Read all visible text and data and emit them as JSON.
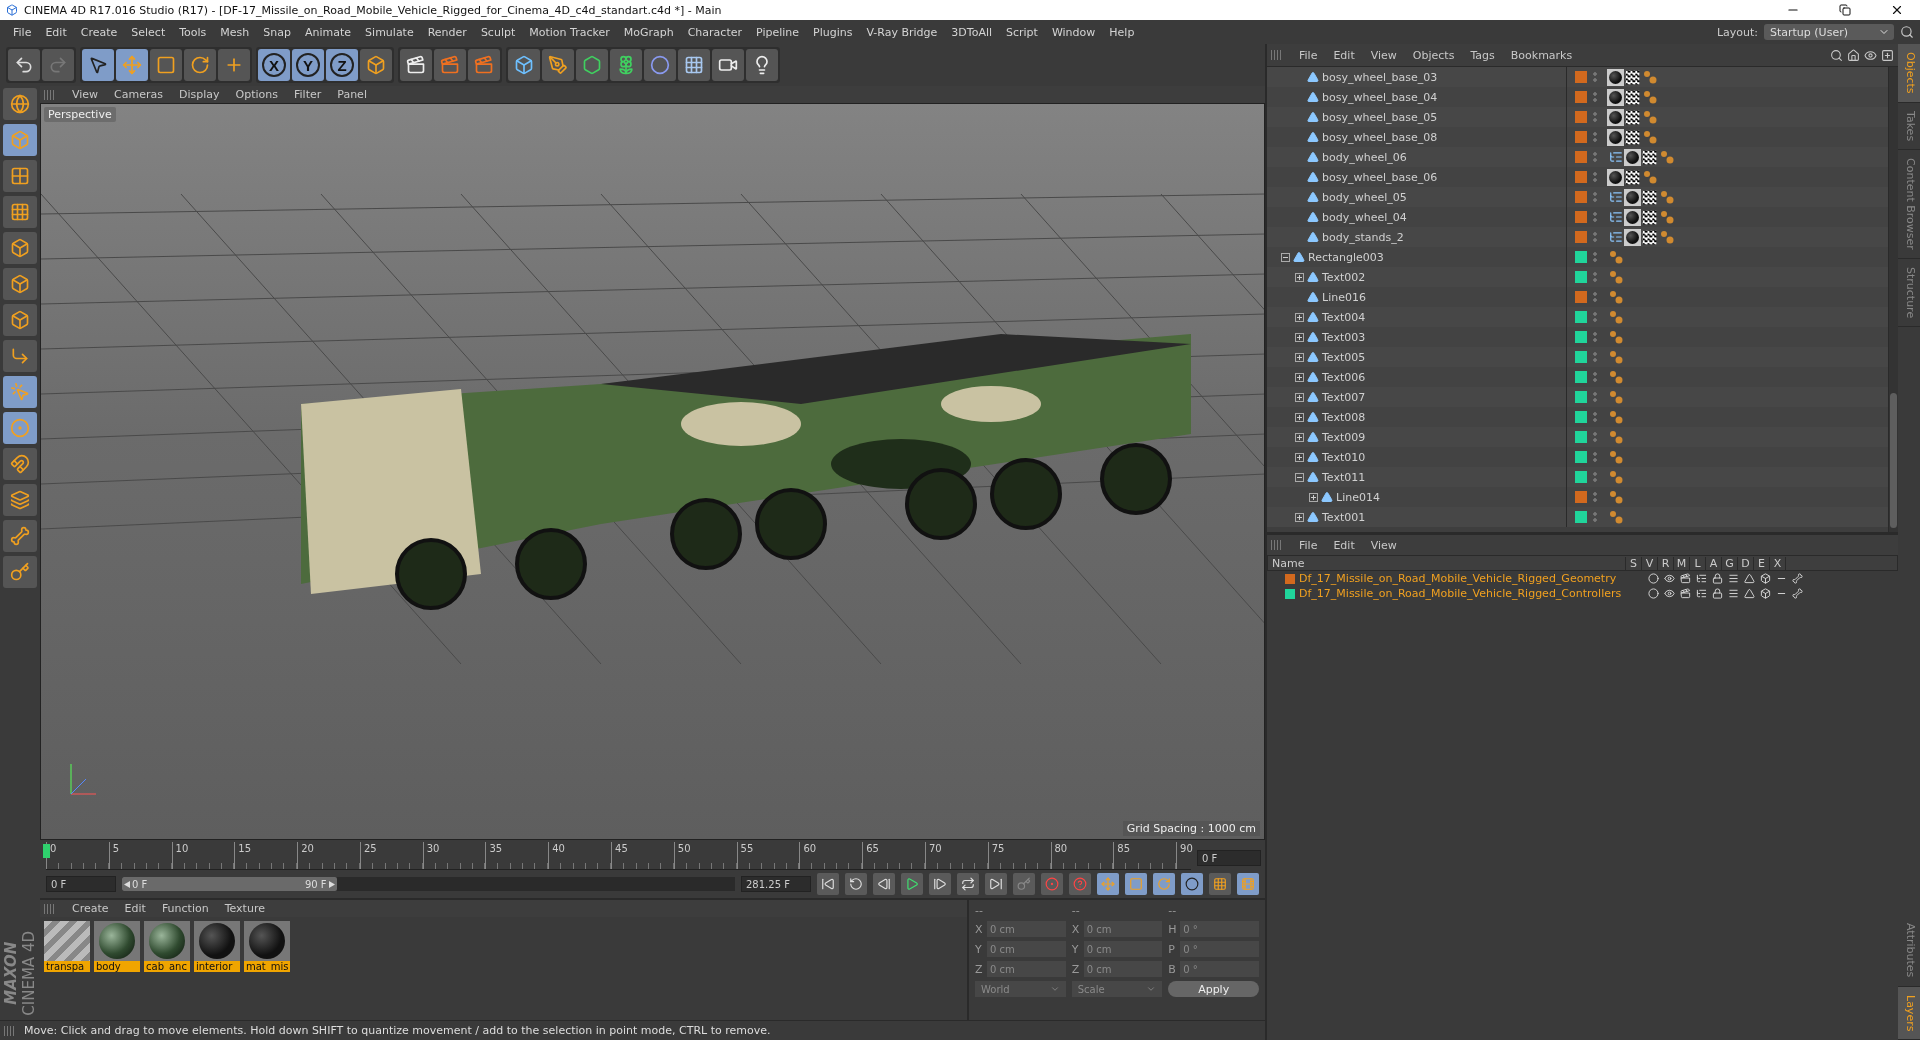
{
  "window": {
    "title": "CINEMA 4D R17.016 Studio (R17) - [DF-17_Missile_on_Road_Mobile_Vehicle_Rigged_for_Cinema_4D_c4d_standart.c4d *] - Main"
  },
  "menu": [
    "File",
    "Edit",
    "Create",
    "Select",
    "Tools",
    "Mesh",
    "Snap",
    "Animate",
    "Simulate",
    "Render",
    "Sculpt",
    "Motion Tracker",
    "MoGraph",
    "Character",
    "Pipeline",
    "Plugins",
    "V-Ray Bridge",
    "3DToAll",
    "Script",
    "Window",
    "Help"
  ],
  "layout": {
    "label": "Layout:",
    "value": "Startup (User)"
  },
  "axis_buttons": [
    "X",
    "Y",
    "Z"
  ],
  "viewport": {
    "menu": [
      "View",
      "Cameras",
      "Display",
      "Options",
      "Filter",
      "Panel"
    ],
    "camera": "Perspective",
    "grid_spacing": "Grid Spacing : 1000 cm"
  },
  "object_manager": {
    "menu": [
      "File",
      "Edit",
      "View",
      "Objects",
      "Tags",
      "Bookmarks"
    ],
    "partial_children": [
      {
        "name": "bosy_wheel_base_03",
        "color": "#d2691e",
        "skinned": false,
        "textured": true
      },
      {
        "name": "bosy_wheel_base_04",
        "color": "#d2691e",
        "skinned": false,
        "textured": true
      },
      {
        "name": "bosy_wheel_base_05",
        "color": "#d2691e",
        "skinned": false,
        "textured": true
      },
      {
        "name": "bosy_wheel_base_08",
        "color": "#d2691e",
        "skinned": false,
        "textured": true
      },
      {
        "name": "body_wheel_06",
        "color": "#d2691e",
        "skinned": true,
        "textured": true
      },
      {
        "name": "bosy_wheel_base_06",
        "color": "#d2691e",
        "skinned": false,
        "textured": true
      },
      {
        "name": "body_wheel_05",
        "color": "#d2691e",
        "skinned": true,
        "textured": true
      },
      {
        "name": "body_wheel_04",
        "color": "#d2691e",
        "skinned": true,
        "textured": true
      },
      {
        "name": "body_stands_2",
        "color": "#d2691e",
        "skinned": true,
        "textured": true
      }
    ],
    "items": [
      {
        "name": "Rectangle003",
        "color": "#20d59b",
        "skinned": false,
        "textured": false,
        "expanded": true,
        "children": [
          {
            "name": "Text002",
            "color": "#20d59b",
            "skinned": false,
            "textured": false,
            "expanded": false
          },
          {
            "name": "Line016",
            "color": "#d2691e",
            "skinned": false,
            "textured": false
          },
          {
            "name": "Text004",
            "color": "#20d59b",
            "skinned": false,
            "textured": false,
            "expanded": false
          },
          {
            "name": "Text003",
            "color": "#20d59b",
            "skinned": false,
            "textured": false,
            "expanded": false
          },
          {
            "name": "Text005",
            "color": "#20d59b",
            "skinned": false,
            "textured": false,
            "expanded": false
          },
          {
            "name": "Text006",
            "color": "#20d59b",
            "skinned": false,
            "textured": false,
            "expanded": false
          },
          {
            "name": "Text007",
            "color": "#20d59b",
            "skinned": false,
            "textured": false,
            "expanded": false
          },
          {
            "name": "Text008",
            "color": "#20d59b",
            "skinned": false,
            "textured": false,
            "expanded": false
          },
          {
            "name": "Text009",
            "color": "#20d59b",
            "skinned": false,
            "textured": false,
            "expanded": false
          },
          {
            "name": "Text010",
            "color": "#20d59b",
            "skinned": false,
            "textured": false,
            "expanded": false
          },
          {
            "name": "Text011",
            "color": "#20d59b",
            "skinned": false,
            "textured": false,
            "expanded": true,
            "children": [
              {
                "name": "Line014",
                "color": "#d2691e",
                "skinned": false,
                "textured": false,
                "expanded": false
              }
            ]
          },
          {
            "name": "Text001",
            "color": "#20d59b",
            "skinned": false,
            "textured": false,
            "expanded": false
          }
        ]
      }
    ]
  },
  "side_tabs_top": [
    {
      "label": "Objects",
      "selected": true
    },
    {
      "label": "Takes",
      "selected": false
    },
    {
      "label": "Content Browser",
      "selected": false
    },
    {
      "label": "Structure",
      "selected": false
    }
  ],
  "side_tabs_bottom": [
    {
      "label": "Attributes",
      "selected": false
    },
    {
      "label": "Layers",
      "selected": true
    }
  ],
  "layer_manager": {
    "menu": [
      "File",
      "Edit",
      "View"
    ],
    "columns": [
      "Name",
      "S",
      "V",
      "R",
      "M",
      "L",
      "A",
      "G",
      "D",
      "E",
      "X"
    ],
    "layers": [
      {
        "name": "Df_17_Missile_on_Road_Mobile_Vehicle_Rigged_Geometry",
        "color": "#d2691e"
      },
      {
        "name": "Df_17_Missile_on_Road_Mobile_Vehicle_Rigged_Controllers",
        "color": "#20d59b"
      }
    ]
  },
  "timeline": {
    "ticks": [
      "0",
      "5",
      "10",
      "15",
      "20",
      "25",
      "30",
      "35",
      "40",
      "45",
      "50",
      "55",
      "60",
      "65",
      "70",
      "75",
      "80",
      "85",
      "90"
    ],
    "level": 0,
    "current": "0 F",
    "start": "0 F",
    "range": {
      "start": "0 F",
      "end": "90 F",
      "level": 0.35
    },
    "end": "281.25 F"
  },
  "materials": {
    "menu": [
      "Create",
      "Edit",
      "Function",
      "Texture"
    ],
    "items": [
      {
        "name": "transpa",
        "kind": "striped"
      },
      {
        "name": "body",
        "kind": "camo"
      },
      {
        "name": "cab_anc",
        "kind": "camo"
      },
      {
        "name": "interior",
        "kind": "dark"
      },
      {
        "name": "mat_mis",
        "kind": "dark"
      }
    ]
  },
  "coordinates": {
    "headers": [
      "--",
      "--",
      "--"
    ],
    "rows": [
      [
        {
          "axis": "X",
          "value": "0 cm"
        },
        {
          "axis": "X",
          "value": "0 cm"
        },
        {
          "axis": "H",
          "value": "0 °"
        }
      ],
      [
        {
          "axis": "Y",
          "value": "0 cm"
        },
        {
          "axis": "Y",
          "value": "0 cm"
        },
        {
          "axis": "P",
          "value": "0 °"
        }
      ],
      [
        {
          "axis": "Z",
          "value": "0 cm"
        },
        {
          "axis": "Z",
          "value": "0 cm"
        },
        {
          "axis": "B",
          "value": "0 °"
        }
      ]
    ],
    "dropdowns": [
      "World",
      "Scale"
    ],
    "apply": "Apply"
  },
  "logo": {
    "brand": "MAXON",
    "product": "CINEMA 4D"
  },
  "status_bar": "Move: Click and drag to move elements. Hold down SHIFT to quantize movement / add to the selection in point mode, CTRL to remove."
}
